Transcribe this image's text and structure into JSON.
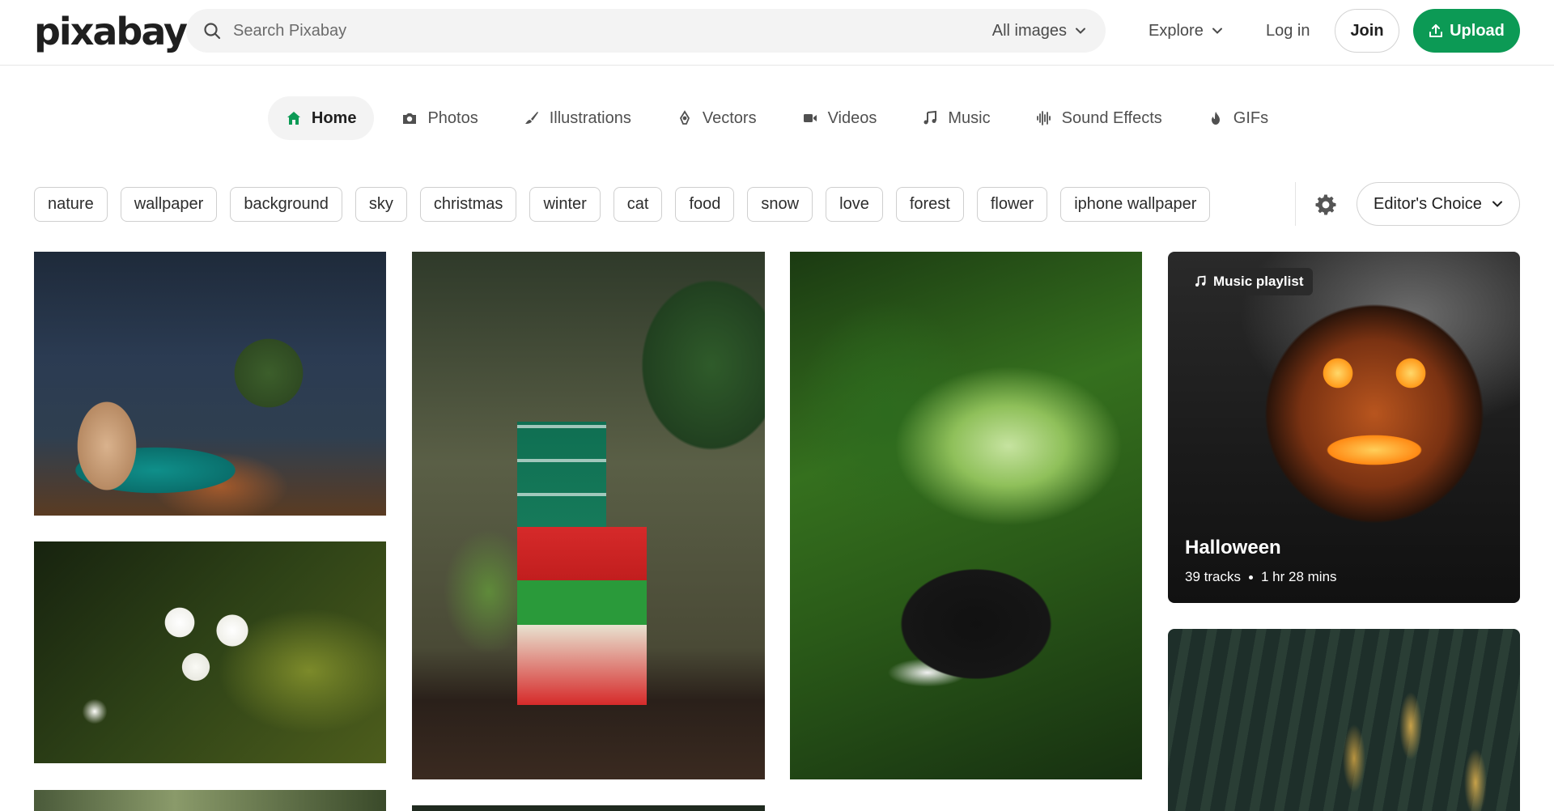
{
  "header": {
    "logo": "pixabay",
    "search_placeholder": "Search Pixabay",
    "search_scope": "All images",
    "explore_label": "Explore",
    "login_label": "Log in",
    "join_label": "Join",
    "upload_label": "Upload",
    "brand_color": "#0c9a55"
  },
  "media_tabs": [
    {
      "label": "Home",
      "icon": "home-icon",
      "active": true
    },
    {
      "label": "Photos",
      "icon": "camera-icon"
    },
    {
      "label": "Illustrations",
      "icon": "brush-icon"
    },
    {
      "label": "Vectors",
      "icon": "pen-nib-icon"
    },
    {
      "label": "Videos",
      "icon": "video-camera-icon"
    },
    {
      "label": "Music",
      "icon": "music-note-icon"
    },
    {
      "label": "Sound Effects",
      "icon": "waveform-icon"
    },
    {
      "label": "GIFs",
      "icon": "flame-icon"
    }
  ],
  "tags": [
    "nature",
    "wallpaper",
    "background",
    "sky",
    "christmas",
    "winter",
    "cat",
    "food",
    "snow",
    "love",
    "forest",
    "flower",
    "iphone wallpaper"
  ],
  "sort": {
    "label": "Editor's Choice"
  },
  "playlist": {
    "badge": "Music playlist",
    "title": "Halloween",
    "tracks": "39 tracks",
    "duration": "1 hr 28 mins"
  }
}
